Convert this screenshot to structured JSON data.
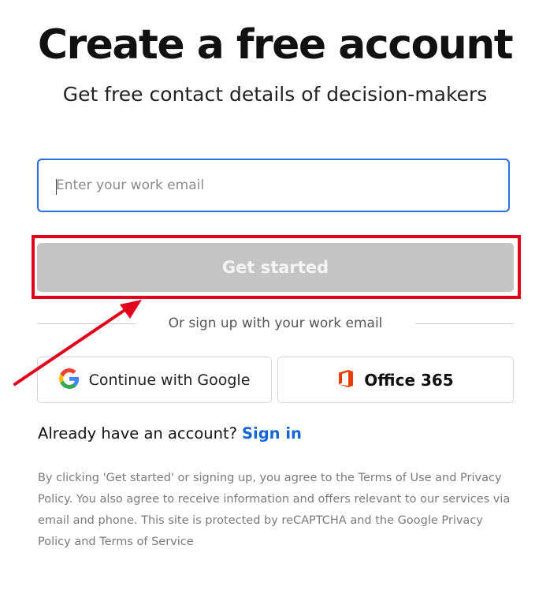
{
  "header": {
    "title": "Create a free account",
    "subtitle": "Get free contact details of decision-makers"
  },
  "form": {
    "email_placeholder": "Enter your work email",
    "email_value": "",
    "submit_label": "Get started"
  },
  "divider": {
    "text": "Or sign up with your work email"
  },
  "sso": {
    "google_label": "Continue with Google",
    "google_icon": "google-g-logo",
    "office_label": "Office 365",
    "office_icon": "office-365-logo"
  },
  "signin": {
    "prompt": "Already have an account?",
    "link_label": "Sign in"
  },
  "legal": {
    "text": "By clicking 'Get started' or signing up, you agree to the Terms of Use and Privacy Policy. You also agree to receive information and offers relevant to our services via email and phone. This site is protected by reCAPTCHA and the Google Privacy Policy and Terms of Service"
  },
  "colors": {
    "accent_blue": "#1464d8",
    "input_border": "#2f6fd8",
    "button_disabled": "#c4c4c4",
    "annotation_red": "#e3001b",
    "office_orange": "#eb3c00"
  }
}
